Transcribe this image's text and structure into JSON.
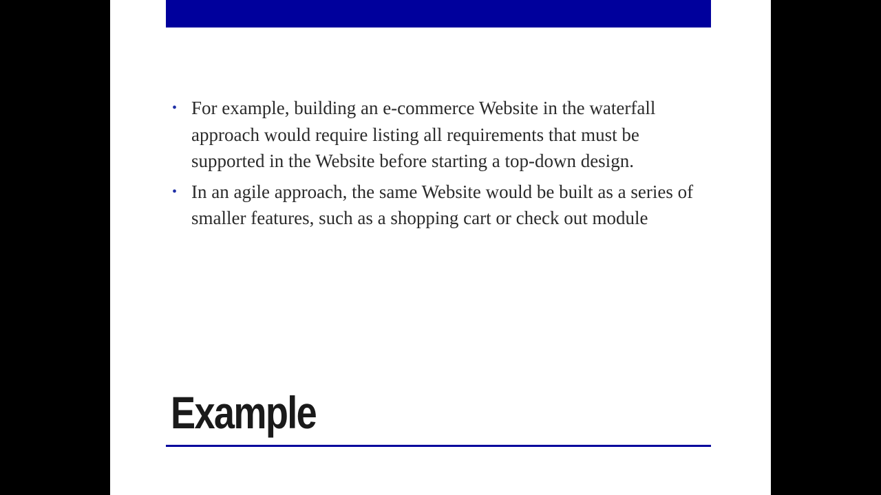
{
  "slide": {
    "title": "Example",
    "bullets": [
      "For example, building an e-commerce Website in the waterfall approach would require listing all requirements that must be supported in the Website before starting a top-down design.",
      "In an agile approach, the same Website would be built as a series of smaller features, such as a shopping cart or check out module"
    ],
    "bullet_glyph": "•"
  },
  "colors": {
    "accent": "#00009c",
    "background_outer": "#000000",
    "slide_background": "#ffffff",
    "bullet": "#1f2fa6",
    "text": "#2b2b2b"
  }
}
